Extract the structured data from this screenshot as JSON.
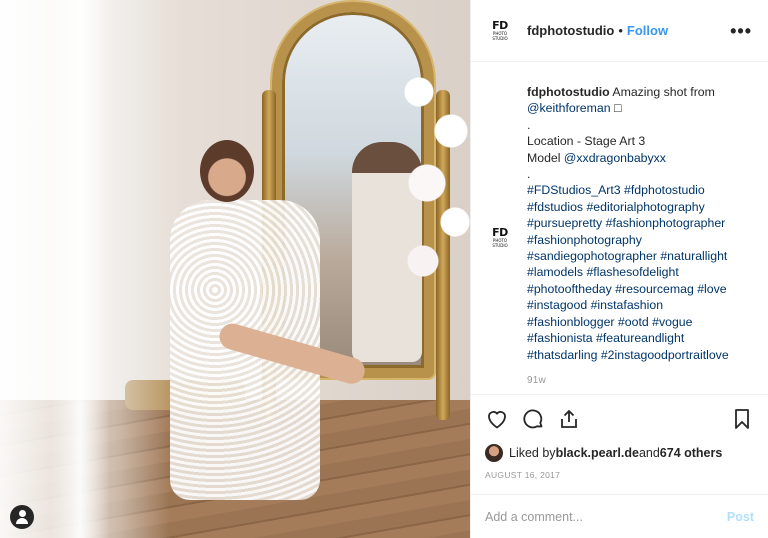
{
  "post": {
    "username": "fdphotostudio",
    "separator": "•",
    "follow_label": "Follow",
    "more_label": "•••",
    "logo_text_big": "FD",
    "logo_text_small": "PHOTO STUDIO"
  },
  "caption": {
    "username": "fdphotostudio",
    "line1": " Amazing shot from",
    "mention1": "@keithforeman",
    "line1_suffix": " □",
    "dot1": ".",
    "location": "Location - Stage Art 3",
    "model_label": "Model ",
    "mention2": "@xxdragonbabyxx",
    "dot2": ".",
    "hashtags": [
      "#FDStudios_Art3 #fdphotostudio",
      "#fdstudios #editorialphotography",
      "#pursuepretty #fashionphotographer",
      "#fashionphotography",
      "#sandiegophotographer #naturallight",
      "#lamodels #flashesofdelight",
      "#photooftheday #resourcemag #love",
      "#instagood #instafashion",
      "#fashionblogger #ootd #vogue",
      "#fashionista #featureandlight",
      "#thatsdarling #2instagoodportraitlove"
    ],
    "time_ago": "91w"
  },
  "icons": [
    "heart-icon",
    "comment-icon",
    "share-icon",
    "bookmark-icon",
    "user-icon"
  ],
  "likes": {
    "prefix": "Liked by ",
    "user": "black.pearl.de",
    "middle": " and ",
    "others": "674 others"
  },
  "date": "AUGUST 16, 2017",
  "add_comment": {
    "placeholder": "Add a comment...",
    "post_label": "Post"
  },
  "colors": {
    "accent": "#3897f0",
    "post_disabled": "#b2dffc",
    "tag": "#003569"
  }
}
